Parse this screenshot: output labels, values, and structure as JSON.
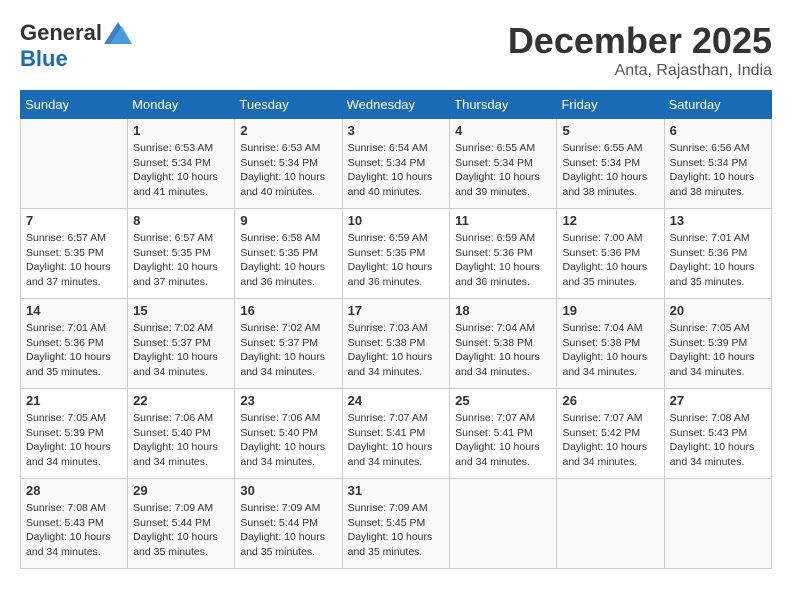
{
  "header": {
    "logo_general": "General",
    "logo_blue": "Blue",
    "month": "December 2025",
    "location": "Anta, Rajasthan, India"
  },
  "weekdays": [
    "Sunday",
    "Monday",
    "Tuesday",
    "Wednesday",
    "Thursday",
    "Friday",
    "Saturday"
  ],
  "weeks": [
    [
      {
        "num": "",
        "info": ""
      },
      {
        "num": "1",
        "info": "Sunrise: 6:53 AM\nSunset: 5:34 PM\nDaylight: 10 hours\nand 41 minutes."
      },
      {
        "num": "2",
        "info": "Sunrise: 6:53 AM\nSunset: 5:34 PM\nDaylight: 10 hours\nand 40 minutes."
      },
      {
        "num": "3",
        "info": "Sunrise: 6:54 AM\nSunset: 5:34 PM\nDaylight: 10 hours\nand 40 minutes."
      },
      {
        "num": "4",
        "info": "Sunrise: 6:55 AM\nSunset: 5:34 PM\nDaylight: 10 hours\nand 39 minutes."
      },
      {
        "num": "5",
        "info": "Sunrise: 6:55 AM\nSunset: 5:34 PM\nDaylight: 10 hours\nand 38 minutes."
      },
      {
        "num": "6",
        "info": "Sunrise: 6:56 AM\nSunset: 5:34 PM\nDaylight: 10 hours\nand 38 minutes."
      }
    ],
    [
      {
        "num": "7",
        "info": "Sunrise: 6:57 AM\nSunset: 5:35 PM\nDaylight: 10 hours\nand 37 minutes."
      },
      {
        "num": "8",
        "info": "Sunrise: 6:57 AM\nSunset: 5:35 PM\nDaylight: 10 hours\nand 37 minutes."
      },
      {
        "num": "9",
        "info": "Sunrise: 6:58 AM\nSunset: 5:35 PM\nDaylight: 10 hours\nand 36 minutes."
      },
      {
        "num": "10",
        "info": "Sunrise: 6:59 AM\nSunset: 5:35 PM\nDaylight: 10 hours\nand 36 minutes."
      },
      {
        "num": "11",
        "info": "Sunrise: 6:59 AM\nSunset: 5:36 PM\nDaylight: 10 hours\nand 36 minutes."
      },
      {
        "num": "12",
        "info": "Sunrise: 7:00 AM\nSunset: 5:36 PM\nDaylight: 10 hours\nand 35 minutes."
      },
      {
        "num": "13",
        "info": "Sunrise: 7:01 AM\nSunset: 5:36 PM\nDaylight: 10 hours\nand 35 minutes."
      }
    ],
    [
      {
        "num": "14",
        "info": "Sunrise: 7:01 AM\nSunset: 5:36 PM\nDaylight: 10 hours\nand 35 minutes."
      },
      {
        "num": "15",
        "info": "Sunrise: 7:02 AM\nSunset: 5:37 PM\nDaylight: 10 hours\nand 34 minutes."
      },
      {
        "num": "16",
        "info": "Sunrise: 7:02 AM\nSunset: 5:37 PM\nDaylight: 10 hours\nand 34 minutes."
      },
      {
        "num": "17",
        "info": "Sunrise: 7:03 AM\nSunset: 5:38 PM\nDaylight: 10 hours\nand 34 minutes."
      },
      {
        "num": "18",
        "info": "Sunrise: 7:04 AM\nSunset: 5:38 PM\nDaylight: 10 hours\nand 34 minutes."
      },
      {
        "num": "19",
        "info": "Sunrise: 7:04 AM\nSunset: 5:38 PM\nDaylight: 10 hours\nand 34 minutes."
      },
      {
        "num": "20",
        "info": "Sunrise: 7:05 AM\nSunset: 5:39 PM\nDaylight: 10 hours\nand 34 minutes."
      }
    ],
    [
      {
        "num": "21",
        "info": "Sunrise: 7:05 AM\nSunset: 5:39 PM\nDaylight: 10 hours\nand 34 minutes."
      },
      {
        "num": "22",
        "info": "Sunrise: 7:06 AM\nSunset: 5:40 PM\nDaylight: 10 hours\nand 34 minutes."
      },
      {
        "num": "23",
        "info": "Sunrise: 7:06 AM\nSunset: 5:40 PM\nDaylight: 10 hours\nand 34 minutes."
      },
      {
        "num": "24",
        "info": "Sunrise: 7:07 AM\nSunset: 5:41 PM\nDaylight: 10 hours\nand 34 minutes."
      },
      {
        "num": "25",
        "info": "Sunrise: 7:07 AM\nSunset: 5:41 PM\nDaylight: 10 hours\nand 34 minutes."
      },
      {
        "num": "26",
        "info": "Sunrise: 7:07 AM\nSunset: 5:42 PM\nDaylight: 10 hours\nand 34 minutes."
      },
      {
        "num": "27",
        "info": "Sunrise: 7:08 AM\nSunset: 5:43 PM\nDaylight: 10 hours\nand 34 minutes."
      }
    ],
    [
      {
        "num": "28",
        "info": "Sunrise: 7:08 AM\nSunset: 5:43 PM\nDaylight: 10 hours\nand 34 minutes."
      },
      {
        "num": "29",
        "info": "Sunrise: 7:09 AM\nSunset: 5:44 PM\nDaylight: 10 hours\nand 35 minutes."
      },
      {
        "num": "30",
        "info": "Sunrise: 7:09 AM\nSunset: 5:44 PM\nDaylight: 10 hours\nand 35 minutes."
      },
      {
        "num": "31",
        "info": "Sunrise: 7:09 AM\nSunset: 5:45 PM\nDaylight: 10 hours\nand 35 minutes."
      },
      {
        "num": "",
        "info": ""
      },
      {
        "num": "",
        "info": ""
      },
      {
        "num": "",
        "info": ""
      }
    ]
  ]
}
